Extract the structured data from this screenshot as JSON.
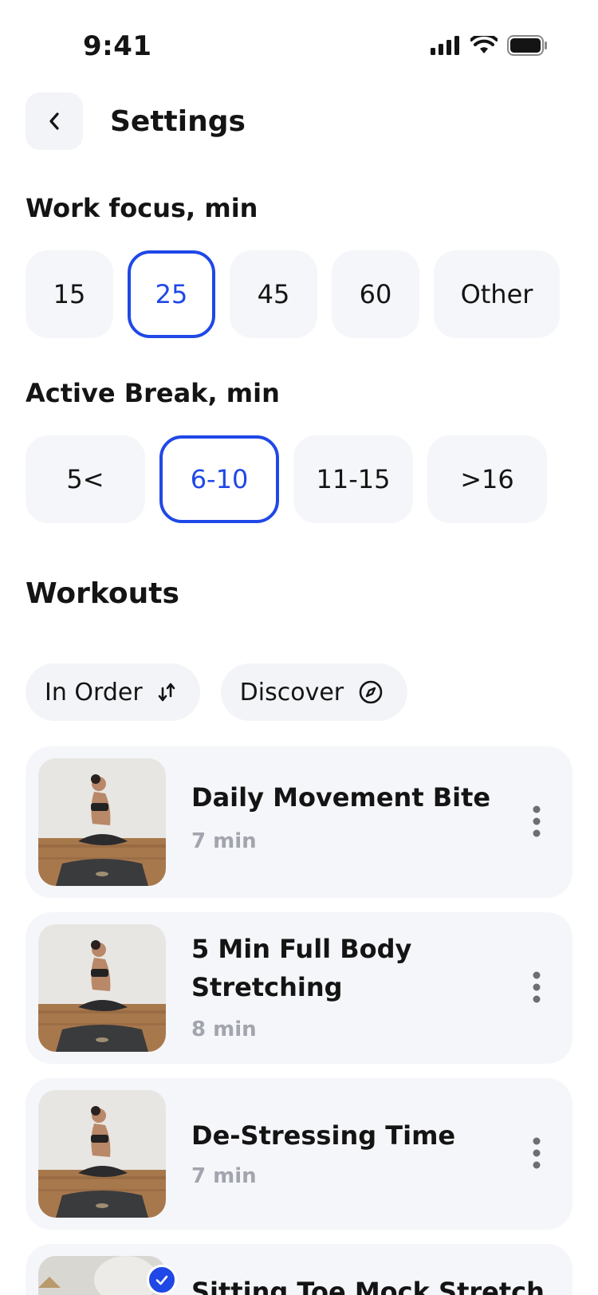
{
  "status_bar": {
    "time": "9:41"
  },
  "header": {
    "title": "Settings"
  },
  "work_focus": {
    "title": "Work focus, min",
    "options": [
      "15",
      "25",
      "45",
      "60",
      "Other"
    ],
    "selected": "25"
  },
  "active_break": {
    "title": "Active Break, min",
    "options": [
      "5<",
      "6-10",
      "11-15",
      ">16"
    ],
    "selected": "6-10"
  },
  "workouts": {
    "title": "Workouts",
    "filters": [
      "In Order",
      "Discover"
    ],
    "items": [
      {
        "title": "Daily Movement Bite",
        "duration": "7 min"
      },
      {
        "title": "5 Min Full Body Stretching",
        "duration": "8 min"
      },
      {
        "title": "De-Stressing Time",
        "duration": "7 min"
      },
      {
        "title": "Sitting Toe Mock Stretch",
        "duration": ""
      }
    ]
  },
  "colors": {
    "accent": "#1f48e6",
    "card_bg": "#f5f6f9",
    "muted_text": "#a2a5ad"
  }
}
